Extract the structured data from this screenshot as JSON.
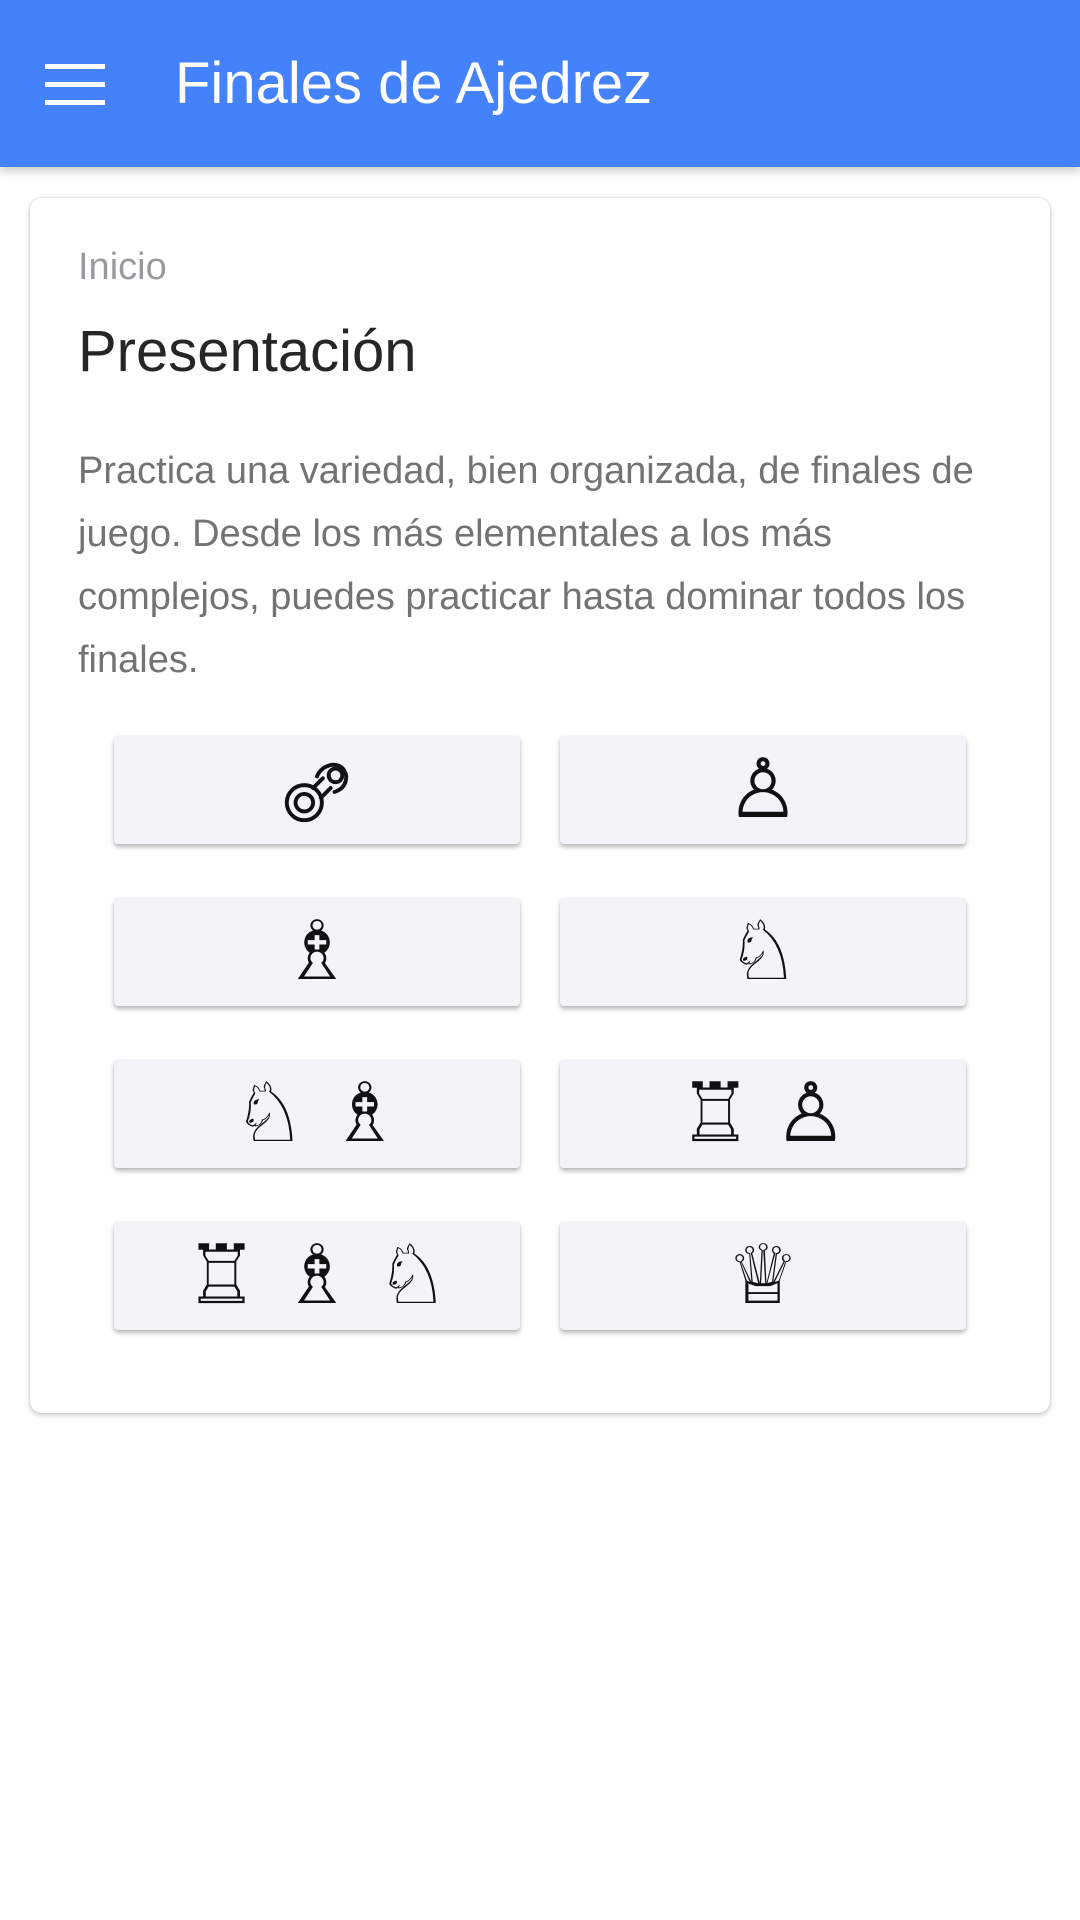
{
  "header": {
    "title": "Finales de Ajedrez",
    "menu_icon": "hamburger-menu-icon",
    "background_color": "#4482fb"
  },
  "card": {
    "breadcrumb": "Inicio",
    "title": "Presentación",
    "description": "Practica una variedad, bien organizada, de finales de juego. Desde los más elementales a los más complejos, puedes practicar hasta dominar todos los finales."
  },
  "categories": [
    {
      "icons": [
        "pacifier-icon"
      ],
      "glyphs": [
        ""
      ]
    },
    {
      "icons": [
        "white-pawn-icon"
      ],
      "glyphs": [
        "♙"
      ]
    },
    {
      "icons": [
        "white-bishop-icon"
      ],
      "glyphs": [
        "♗"
      ]
    },
    {
      "icons": [
        "white-knight-icon"
      ],
      "glyphs": [
        "♘"
      ]
    },
    {
      "icons": [
        "white-knight-icon",
        "white-bishop-icon"
      ],
      "glyphs": [
        "♘",
        "♗"
      ]
    },
    {
      "icons": [
        "white-rook-icon",
        "white-pawn-icon"
      ],
      "glyphs": [
        "♖",
        "♙"
      ]
    },
    {
      "icons": [
        "white-rook-icon",
        "white-bishop-icon",
        "white-knight-icon"
      ],
      "glyphs": [
        "♖",
        "♗",
        "♘"
      ]
    },
    {
      "icons": [
        "white-queen-icon"
      ],
      "glyphs": [
        "♕"
      ]
    }
  ]
}
